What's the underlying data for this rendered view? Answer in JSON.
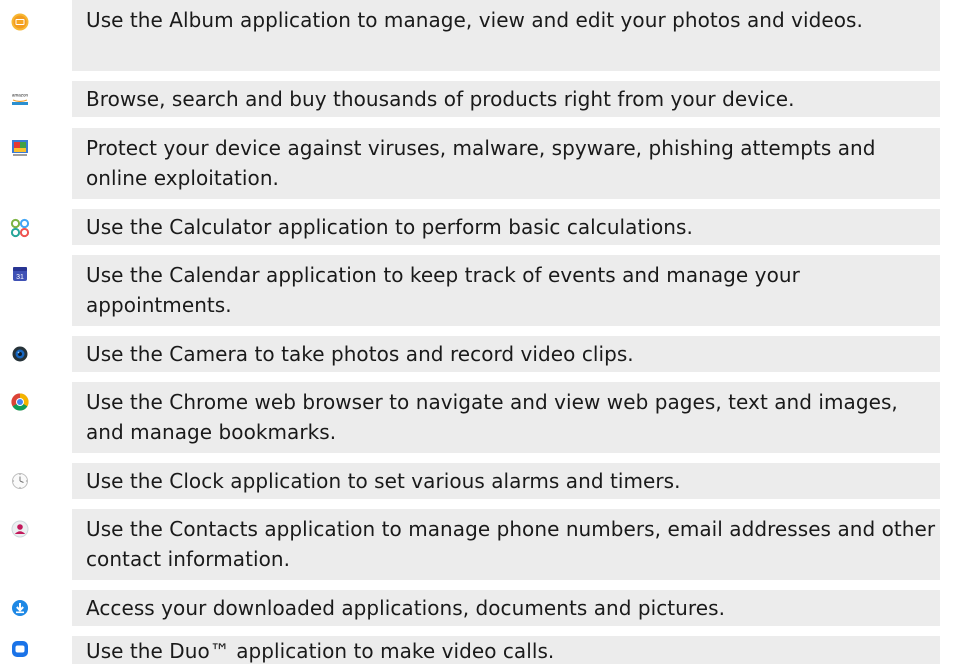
{
  "apps": [
    {
      "icon": "album-icon",
      "description": "Use the Album application to manage, view and edit your photos and videos."
    },
    {
      "icon": "amazon-icon",
      "description": "Browse, search and buy thousands of products right from your device."
    },
    {
      "icon": "antivirus-icon",
      "description": "Protect your device against viruses, malware, spyware, phishing attempts and online exploitation."
    },
    {
      "icon": "calculator-icon",
      "description": "Use the Calculator application to perform basic calculations."
    },
    {
      "icon": "calendar-icon",
      "description": "Use the Calendar application to keep track of events and manage your appointments."
    },
    {
      "icon": "camera-icon",
      "description": "Use the Camera to take photos and record video clips."
    },
    {
      "icon": "chrome-icon",
      "description": "Use the Chrome web browser to navigate and view web pages, text and images, and manage bookmarks."
    },
    {
      "icon": "clock-icon",
      "description": "Use the Clock application to set various alarms and timers."
    },
    {
      "icon": "contacts-icon",
      "description": "Use the Contacts application to manage phone numbers, email addresses and other contact information."
    },
    {
      "icon": "downloads-icon",
      "description": "Access your downloaded applications, documents and pictures."
    },
    {
      "icon": "duo-icon",
      "description": "Use the Duo™ application to make video calls."
    }
  ],
  "icon_text": {
    "amazon": "amazon",
    "calendar_day": "31"
  },
  "colors": {
    "row_background": "#ececec",
    "text": "#1a1a1a",
    "album": "#f5a623",
    "downloads": "#1e88e5",
    "duo": "#1a73e8",
    "contacts": "#c2185b"
  }
}
